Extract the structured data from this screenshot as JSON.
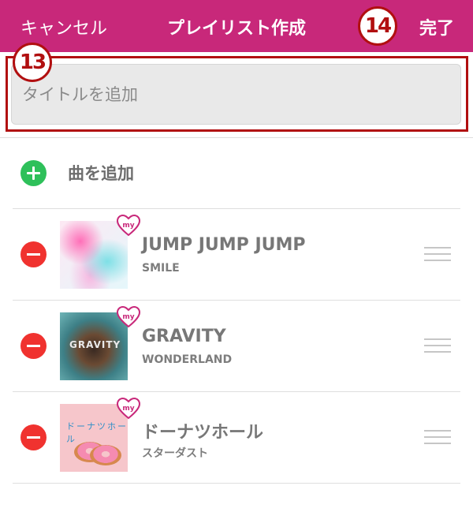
{
  "header": {
    "cancel_label": "キャンセル",
    "title": "プレイリスト作成",
    "done_label": "完了",
    "background_color": "#c8287a"
  },
  "annotations": {
    "badge_title": "13",
    "badge_done": "14",
    "color": "#b10f10"
  },
  "title_input": {
    "placeholder": "タイトルを追加",
    "value": ""
  },
  "add_song": {
    "label": "曲を追加",
    "icon": "plus-circle-icon"
  },
  "songs": [
    {
      "title": "JUMP JUMP JUMP",
      "artist": "SMILE",
      "cover_icon": "album-cover",
      "badge": "my"
    },
    {
      "title": "GRAVITY",
      "artist": "WONDERLAND",
      "cover_icon": "album-cover",
      "cover_text": "GRAVITY",
      "badge": "my"
    },
    {
      "title": "ドーナツホール",
      "artist": "スターダスト",
      "cover_icon": "album-cover",
      "cover_text": "ドーナツホール",
      "badge": "my"
    }
  ],
  "icons": {
    "remove": "minus-circle-icon",
    "drag": "drag-handle-icon",
    "my": "heart-my-icon"
  }
}
